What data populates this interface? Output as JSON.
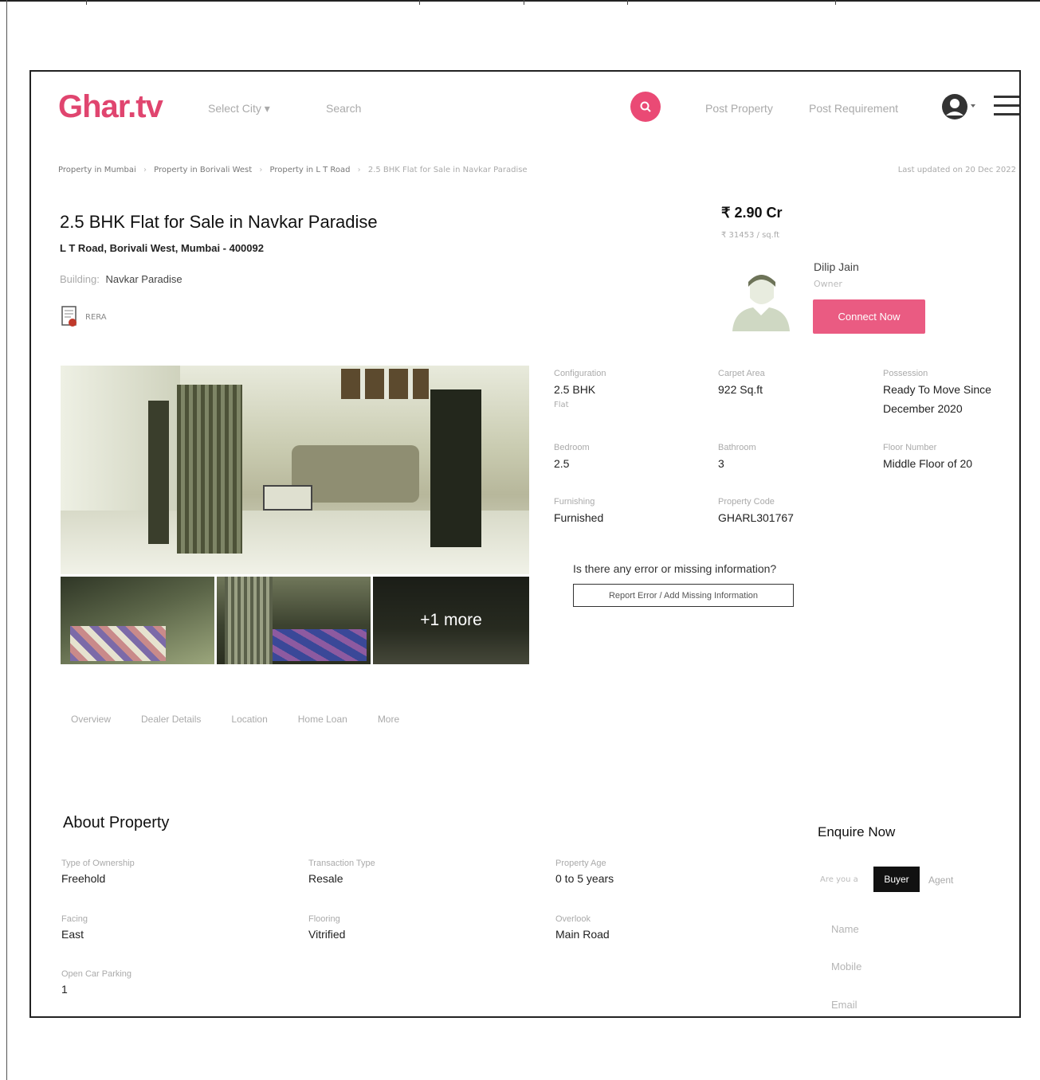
{
  "header": {
    "logo": "Ghar.tv",
    "select_city": "Select City ▾",
    "search_label": "Search",
    "post_property": "Post Property",
    "post_requirement": "Post Requirement",
    "colors": {
      "brand": "#e0456f",
      "accent": "#ea5b82"
    }
  },
  "breadcrumb": {
    "items": [
      "Property in Mumbai",
      "Property in Borivali West",
      "Property in L T Road",
      "2.5 BHK Flat for Sale in Navkar Paradise"
    ],
    "separator": "›",
    "last_updated": "Last updated on 20 Dec 2022"
  },
  "listing": {
    "title": "2.5 BHK Flat for Sale in Navkar Paradise",
    "address": "L T Road, Borivali West, Mumbai - 400092",
    "building_label": "Building:",
    "building_name": "Navkar Paradise",
    "rera_label": "RERA",
    "price": "₹ 2.90 Cr",
    "price_per_sqft": "₹ 31453 / sq.ft"
  },
  "owner": {
    "name": "Dilip Jain",
    "role": "Owner",
    "connect_label": "Connect Now"
  },
  "gallery": {
    "more_label": "+1 more"
  },
  "specs": {
    "configuration": {
      "label": "Configuration",
      "value": "2.5 BHK",
      "sub": "Flat"
    },
    "carpet_area": {
      "label": "Carpet Area",
      "value": "922 Sq.ft"
    },
    "possession": {
      "label": "Possession",
      "value": "Ready To Move Since December 2020"
    },
    "bedroom": {
      "label": "Bedroom",
      "value": "2.5"
    },
    "bathroom": {
      "label": "Bathroom",
      "value": "3"
    },
    "floor_number": {
      "label": "Floor Number",
      "value": "Middle Floor of 20"
    },
    "furnishing": {
      "label": "Furnishing",
      "value": "Furnished"
    },
    "property_code": {
      "label": "Property Code",
      "value": "GHARL301767"
    }
  },
  "error_report": {
    "question": "Is there any error or missing information?",
    "button_label": "Report Error / Add Missing Information"
  },
  "tabs": [
    "Overview",
    "Dealer Details",
    "Location",
    "Home Loan",
    "More"
  ],
  "about": {
    "title": "About Property",
    "items": [
      {
        "label": "Type of Ownership",
        "value": "Freehold"
      },
      {
        "label": "Transaction Type",
        "value": "Resale"
      },
      {
        "label": "Property Age",
        "value": "0 to 5 years"
      },
      {
        "label": "Facing",
        "value": "East"
      },
      {
        "label": "Flooring",
        "value": "Vitrified"
      },
      {
        "label": "Overlook",
        "value": "Main Road"
      },
      {
        "label": "Open Car Parking",
        "value": "1"
      }
    ]
  },
  "enquire": {
    "title": "Enquire Now",
    "are_you_label": "Are you a",
    "buyer_label": "Buyer",
    "agent_label": "Agent",
    "name_placeholder": "Name",
    "mobile_placeholder": "Mobile",
    "email_placeholder": "Email"
  }
}
